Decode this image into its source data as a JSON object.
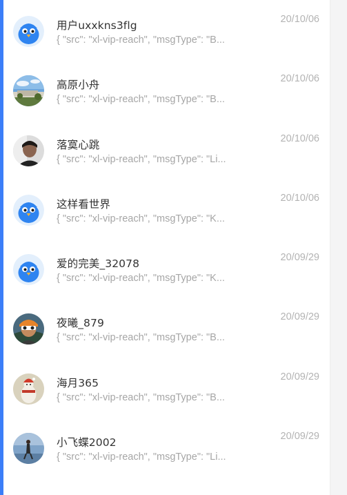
{
  "conversations": [
    {
      "name": "用户uxxkns3flg",
      "preview": "{ \"src\": \"xl-vip-reach\", \"msgType\": \"B...",
      "date": "20/10/06",
      "avatar": "default-bird-avatar"
    },
    {
      "name": "高原小舟",
      "preview": "{ \"src\": \"xl-vip-reach\", \"msgType\": \"B...",
      "date": "20/10/06",
      "avatar": "photo-avatar"
    },
    {
      "name": "落寞心跳",
      "preview": "{ \"src\": \"xl-vip-reach\", \"msgType\": \"Li...",
      "date": "20/10/06",
      "avatar": "photo-avatar"
    },
    {
      "name": "这样看世界",
      "preview": "{ \"src\": \"xl-vip-reach\", \"msgType\": \"K...",
      "date": "20/10/06",
      "avatar": "default-bird-avatar"
    },
    {
      "name": "爱的完美_32078",
      "preview": "{ \"src\": \"xl-vip-reach\", \"msgType\": \"K...",
      "date": "20/09/29",
      "avatar": "default-bird-avatar"
    },
    {
      "name": "夜曦_879",
      "preview": "{ \"src\": \"xl-vip-reach\", \"msgType\": \"B...",
      "date": "20/09/29",
      "avatar": "photo-avatar"
    },
    {
      "name": "海月365",
      "preview": "{ \"src\": \"xl-vip-reach\", \"msgType\": \"B...",
      "date": "20/09/29",
      "avatar": "photo-avatar"
    },
    {
      "name": "小飞蝶2002",
      "preview": "{ \"src\": \"xl-vip-reach\", \"msgType\": \"Li...",
      "date": "20/09/29",
      "avatar": "photo-avatar"
    }
  ],
  "colors": {
    "accent": "#3b7ef8",
    "name_text": "#333333",
    "preview_text": "#a6a6a6",
    "date_text": "#b3b3b3",
    "gutter": "#f4f4f5"
  }
}
